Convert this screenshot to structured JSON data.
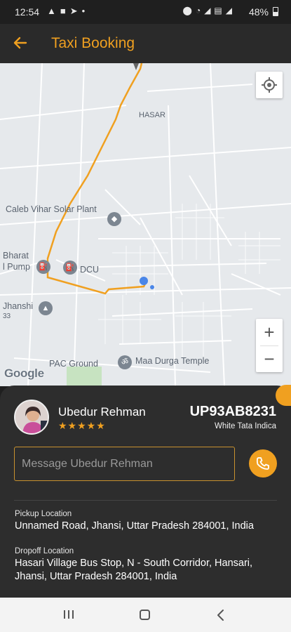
{
  "status": {
    "time": "12:54",
    "left_icons": [
      "warning-icon",
      "message-icon",
      "telegram-icon",
      "dot-icon"
    ],
    "right_icons": [
      "location-icon",
      "wifi-call-icon",
      "signal-icon",
      "volte-icon",
      "signal-2-icon"
    ],
    "battery": "48%"
  },
  "app_bar": {
    "title": "Taxi Booking",
    "accent": "#f0a020"
  },
  "map": {
    "labels": {
      "hasar": "HASAR",
      "caleb": "Caleb Vihar Solar Plant",
      "bharat1": "Bharat",
      "bharat2": "l Pump",
      "dcu": "DCU",
      "jhanshi": "Jhanshi",
      "num33": "33",
      "pac": "PAC Ground",
      "durga": "Maa Durga Temple"
    },
    "zoom_in": "+",
    "zoom_out": "−",
    "attribution": "Google",
    "route_color": "#f0a020"
  },
  "driver": {
    "name": "Ubedur Rehman",
    "rating_stars": "★★★★★",
    "plate": "UP93AB8231",
    "car": "White Tata Indica"
  },
  "message": {
    "placeholder": "Message Ubedur Rehman"
  },
  "pickup": {
    "label": "Pickup Location",
    "address": "Unnamed Road, Jhansi, Uttar Pradesh 284001, India"
  },
  "dropoff": {
    "label": "Dropoff Location",
    "address": "Hasari Village Bus Stop, N - South Corridor, Hansari, Jhansi, Uttar Pradesh 284001, India"
  }
}
